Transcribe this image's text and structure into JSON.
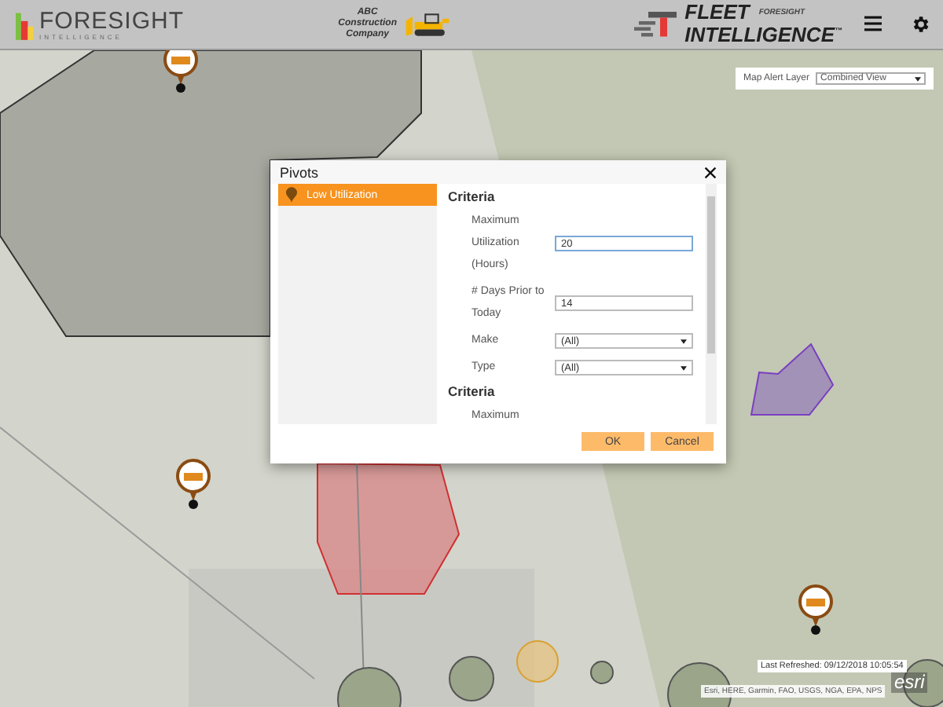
{
  "header": {
    "logo": {
      "name": "FORESIGHT",
      "tagline": "INTELLIGENCE"
    },
    "company": [
      "ABC",
      "Construction",
      "Company"
    ],
    "product": {
      "line1": "FLEET",
      "line2": "INTELLIGENCE",
      "mark": "™",
      "badge": "FORESIGHT"
    }
  },
  "map_alert_layer": {
    "label": "Map Alert Layer",
    "value": "Combined View"
  },
  "dialog": {
    "title": "Pivots",
    "pivots": [
      {
        "label": "Low Utilization",
        "selected": true
      }
    ],
    "sections": [
      {
        "heading": "Criteria",
        "fields": [
          {
            "kind": "text",
            "label": "Maximum Utilization (Hours)",
            "value": "20",
            "focused": true
          },
          {
            "kind": "text",
            "label": "# Days Prior to Today",
            "value": "14",
            "focused": false
          },
          {
            "kind": "select",
            "label": "Make",
            "value": "(All)"
          },
          {
            "kind": "select",
            "label": "Type",
            "value": "(All)"
          }
        ]
      },
      {
        "heading": "Criteria",
        "fields": [
          {
            "kind": "label",
            "label": "Maximum"
          }
        ]
      }
    ],
    "buttons": [
      "OK",
      "Cancel"
    ]
  },
  "last_refreshed": "Last Refreshed: 09/12/2018 10:05:54",
  "attribution": "Esri, HERE, Garmin, FAO, USGS, NGA, EPA, NPS",
  "esri_logo": "esri"
}
